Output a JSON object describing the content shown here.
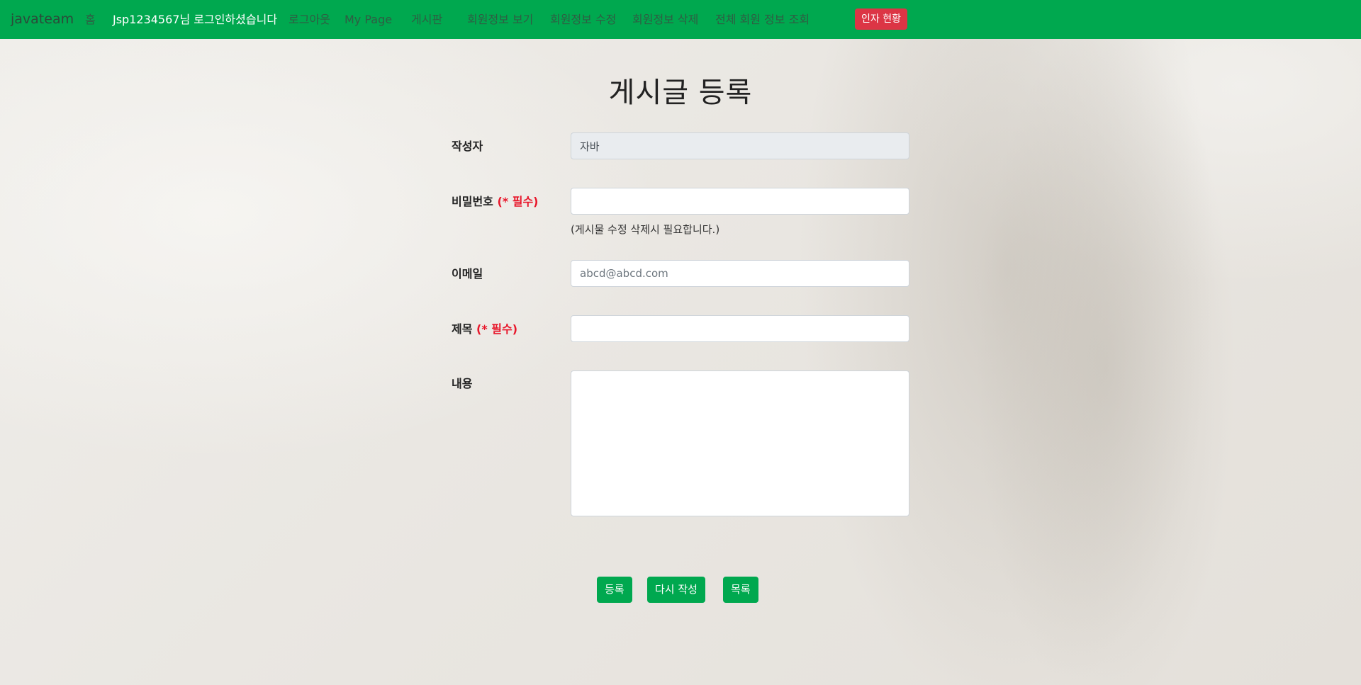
{
  "navbar": {
    "brand": "javateam",
    "home": "홈",
    "user_greeting": "Jsp1234567님 로그인하셨습니다",
    "logout": "로그아웃",
    "my_page": "My Page",
    "board": "게시판",
    "member_view": "회원정보 보기",
    "member_edit": "회원정보 수정",
    "member_delete": "회원정보 삭제",
    "all_members": "전체 회원 정보 조회",
    "badge": "인자 현황",
    "background_color": "#00a84f",
    "badge_color": "#dc3545"
  },
  "page": {
    "title": "게시글 등록"
  },
  "form": {
    "writer": {
      "label": "작성자",
      "value": "자바"
    },
    "password": {
      "label": "비밀번호",
      "required_text": "(* 필수)",
      "value": "",
      "hint": "(게시물 수정 삭제시 필요합니다.)"
    },
    "email": {
      "label": "이메일",
      "placeholder": "abcd@abcd.com"
    },
    "subject": {
      "label": "제목",
      "required_text": "(* 필수)",
      "value": ""
    },
    "content": {
      "label": "내용",
      "value": ""
    }
  },
  "buttons": {
    "submit": "등록",
    "reset": "다시 작성",
    "list": "목록",
    "color": "#00a84f"
  }
}
